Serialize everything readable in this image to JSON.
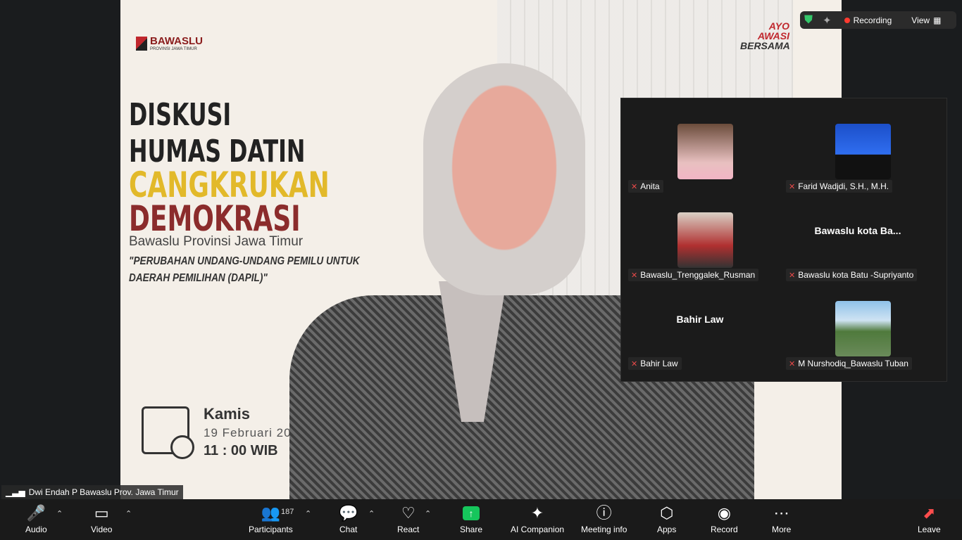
{
  "poster": {
    "org_logo": "BAWASLU",
    "org_logo_sub": "PROVINSI JAWA TIMUR",
    "title_1": "DISKUSI",
    "title_2": "HUMAS DATIN",
    "title_3": "CANGKRUKAN",
    "title_4": "DEMOKRASI",
    "organizer": "Bawaslu Provinsi Jawa Timur",
    "quote_1": "\"PERUBAHAN UNDANG-UNDANG PEMILU UNTUK",
    "quote_2": "DAERAH PEMILIHAN (DAPIL)\"",
    "day": "Kamis",
    "date": "19 Februari 20",
    "time": "11 : 00 WIB",
    "campaign_1": "AYO",
    "campaign_2": "AWASI",
    "campaign_3": "BERSAMA"
  },
  "top_status": {
    "recording_label": "Recording",
    "view_label": "View"
  },
  "gallery": [
    {
      "name": "Anita",
      "display": "photo"
    },
    {
      "name": "Farid Wadjdi, S.H., M.H.",
      "display": "photo"
    },
    {
      "name": "Bawaslu_Trenggalek_Rusman",
      "display": "photo"
    },
    {
      "name": "Bawaslu kota Batu -Supriyanto",
      "display": "name",
      "big_name": "Bawaslu kota Ba..."
    },
    {
      "name": "Bahir Law",
      "display": "name",
      "big_name": "Bahir Law"
    },
    {
      "name": "M Nurshodiq_Bawaslu Tuban",
      "display": "photo"
    }
  ],
  "active_speaker": "Dwi Endah P Bawaslu Prov. Jawa Timur",
  "toolbar": {
    "audio": "Audio",
    "video": "Video",
    "participants": "Participants",
    "participants_count": "187",
    "chat": "Chat",
    "react": "React",
    "share": "Share",
    "ai_companion": "AI Companion",
    "meeting_info": "Meeting info",
    "apps": "Apps",
    "record": "Record",
    "more": "More",
    "leave": "Leave"
  }
}
